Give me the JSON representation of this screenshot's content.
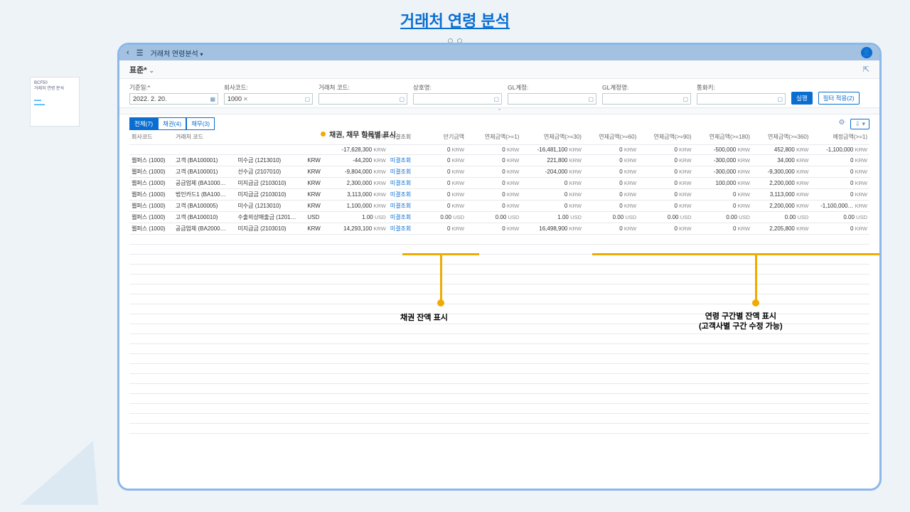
{
  "pageTitle": "거래처 연령 분석",
  "thumbnail": {
    "code": "BCF50",
    "title": "거래처 연령 분석"
  },
  "shell": {
    "navTitle": "거래처 연령분석"
  },
  "variant": {
    "label": "표준*"
  },
  "filters": {
    "baseDate": {
      "label": "기준일:*",
      "value": "2022. 2. 20."
    },
    "companyCode": {
      "label": "회사코드:",
      "value": "1000"
    },
    "partnerCode": {
      "label": "거래처 코드:",
      "value": ""
    },
    "partnerName": {
      "label": "상호명:",
      "value": ""
    },
    "glAccount": {
      "label": "GL계정:",
      "value": ""
    },
    "glAccountName": {
      "label": "GL계정명:",
      "value": ""
    },
    "currencyKey": {
      "label": "통화키:",
      "value": ""
    },
    "goBtn": "실행",
    "adaptBtn": "필터 적용(2)"
  },
  "tabs": [
    {
      "label": "전체(7)",
      "active": true
    },
    {
      "label": "채권(4)",
      "active": false
    },
    {
      "label": "채무(3)",
      "active": false
    }
  ],
  "callouts": {
    "tabs": "채권, 채무 항목별 표시",
    "balance": "채권 잔액 표시",
    "aging1": "연령 구간별 잔액 표시",
    "aging2": "(고객사별 구간 수정 가능)"
  },
  "columns": [
    "회사코드",
    "거래처 코드",
    "",
    "",
    "전표금액",
    "미결조회",
    "만기금액",
    "연체금액(>=1)",
    "연체금액(>=30)",
    "연체금액(>=60)",
    "연체금액(>=90)",
    "연체금액(>=180)",
    "연체금액(>=360)",
    "예정금액(>=1)"
  ],
  "totals": {
    "amount": "-17,628,300",
    "c": "KRW",
    "due": "0",
    "ov1": "0",
    "ov30": "-16,481,100",
    "ov60": "0",
    "ov90": "0",
    "ov180": "-500,000",
    "ov360": "452,800",
    "sched": "-1,100,000"
  },
  "rows": [
    {
      "co": "웹퍼스 (1000)",
      "bp": "고객 (BA100001)",
      "gl": "미수금 (1213010)",
      "cu": "KRW",
      "amt": "-44,200",
      "link": "미결조회",
      "due": "0",
      "ov1": "0",
      "ov30": "221,800",
      "ov60": "0",
      "ov90": "0",
      "ov180": "-300,000",
      "ov360": "34,000",
      "sc": "0"
    },
    {
      "co": "웹퍼스 (1000)",
      "bp": "고객 (BA100001)",
      "gl": "선수금 (2107010)",
      "cu": "KRW",
      "amt": "-9,804,000",
      "link": "미결조회",
      "due": "0",
      "ov1": "0",
      "ov30": "-204,000",
      "ov60": "0",
      "ov90": "0",
      "ov180": "-300,000",
      "ov360": "-9,300,000",
      "sc": "0"
    },
    {
      "co": "웹퍼스 (1000)",
      "bp": "공급업체 (BA1000…",
      "gl": "미지급금 (2103010)",
      "cu": "KRW",
      "amt": "2,300,000",
      "link": "미결조회",
      "due": "0",
      "ov1": "0",
      "ov30": "0",
      "ov60": "0",
      "ov90": "0",
      "ov180": "100,000",
      "ov360": "2,200,000",
      "sc": "0"
    },
    {
      "co": "웹퍼스 (1000)",
      "bp": "법인카드1 (BA100…",
      "gl": "미지급금 (2103010)",
      "cu": "KRW",
      "amt": "3,113,000",
      "link": "미결조회",
      "due": "0",
      "ov1": "0",
      "ov30": "0",
      "ov60": "0",
      "ov90": "0",
      "ov180": "0",
      "ov360": "3,113,000",
      "sc": "0"
    },
    {
      "co": "웹퍼스 (1000)",
      "bp": "고객 (BA100005)",
      "gl": "미수금 (1213010)",
      "cu": "KRW",
      "amt": "1,100,000",
      "link": "미결조회",
      "due": "0",
      "ov1": "0",
      "ov30": "0",
      "ov60": "0",
      "ov90": "0",
      "ov180": "0",
      "ov360": "2,200,000",
      "sc": "-1,100,000…"
    },
    {
      "co": "웹퍼스 (1000)",
      "bp": "고객 (BA100010)",
      "gl": "수출외상매출금 (1201…",
      "cu": "USD",
      "amt": "1.00",
      "link": "미결조회",
      "due": "0.00",
      "ov1": "0.00",
      "ov30": "1.00",
      "ov60": "0.00",
      "ov90": "0.00",
      "ov180": "0.00",
      "ov360": "0.00",
      "sc": "0.00"
    },
    {
      "co": "웹퍼스 (1000)",
      "bp": "공급업체 (BA2000…",
      "gl": "미지급금 (2103010)",
      "cu": "KRW",
      "amt": "14,293,100",
      "link": "미결조회",
      "due": "0",
      "ov1": "0",
      "ov30": "16,498,900",
      "ov60": "0",
      "ov90": "0",
      "ov180": "0",
      "ov360": "2,205,800",
      "sc": "0"
    }
  ]
}
